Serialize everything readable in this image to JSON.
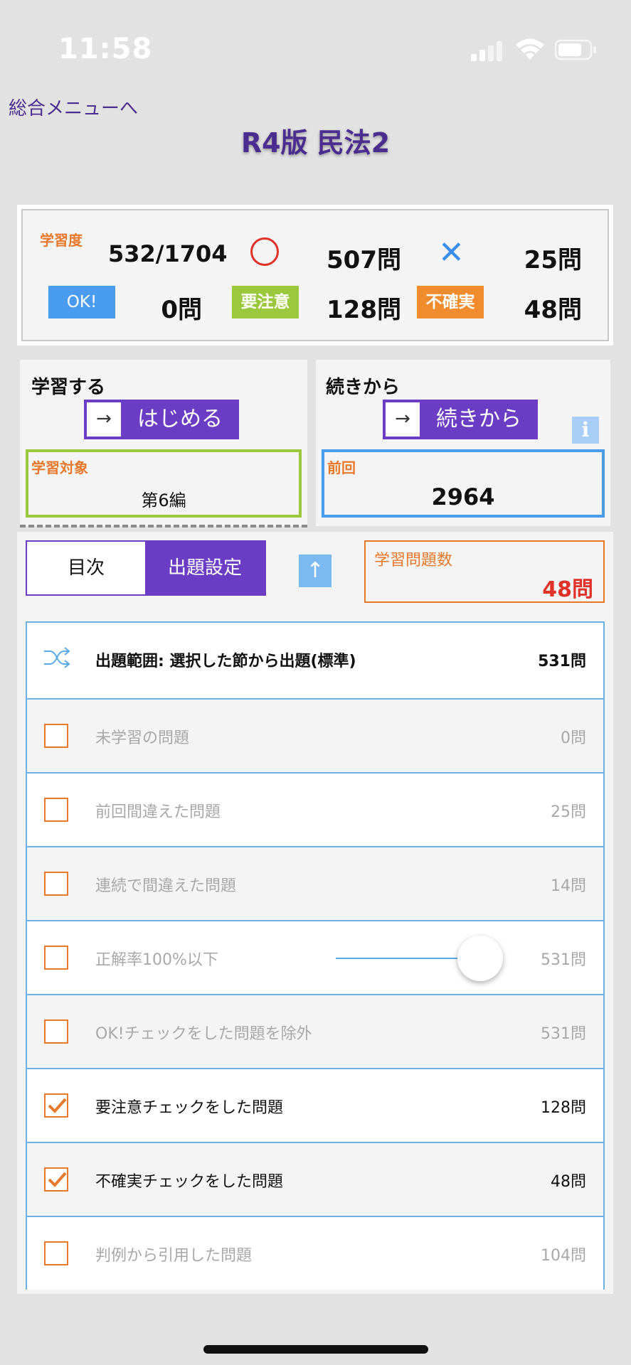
{
  "status": {
    "time": "11:58"
  },
  "header": {
    "back_label": "総合メニューへ",
    "title": "R4版 民法2"
  },
  "summary": {
    "progress_label": "学習度",
    "progress_value": "532/1704",
    "correct_symbol": "○",
    "correct_count": "507問",
    "wrong_symbol": "✕",
    "wrong_count": "25問",
    "ok_tag": "OK!",
    "ok_count": "0問",
    "caution_tag": "要注意",
    "caution_count": "128問",
    "uncertain_tag": "不確実",
    "uncertain_count": "48問"
  },
  "study": {
    "title": "学習する",
    "start_arrow": "→",
    "start_label": "はじめる",
    "target_label": "学習対象",
    "target_value": "第6編"
  },
  "resume": {
    "title": "続きから",
    "resume_arrow": "→",
    "resume_label": "続きから",
    "info_icon": "i",
    "last_label": "前回",
    "last_value": "2964"
  },
  "tabs": {
    "toc": "目次",
    "settings": "出題設定"
  },
  "up_arrow": "↑",
  "question_count": {
    "label": "学習問題数",
    "value": "48問"
  },
  "scope": {
    "label": "出題範囲: 選択した節から出題(標準)",
    "value": "531問"
  },
  "options": [
    {
      "label": "未学習の問題",
      "value": "0問",
      "checked": false
    },
    {
      "label": "前回間違えた問題",
      "value": "25問",
      "checked": false
    },
    {
      "label": "連続で間違えた問題",
      "value": "14問",
      "checked": false
    },
    {
      "label": "正解率100%以下",
      "value": "531問",
      "checked": false,
      "slider_level": 0.95
    },
    {
      "label": "OK!チェックをした問題を除外",
      "value": "531問",
      "checked": false
    },
    {
      "label": "要注意チェックをした問題",
      "value": "128問",
      "checked": true
    },
    {
      "label": "不確実チェックをした問題",
      "value": "48問",
      "checked": true
    },
    {
      "label": "判例から引用した問題",
      "value": "104問",
      "checked": false
    }
  ],
  "colors": {
    "purple": "#6a3dc4",
    "orange": "#e8782a",
    "green": "#9bc83c",
    "blue": "#4a9cf0",
    "red": "#e0312a"
  }
}
